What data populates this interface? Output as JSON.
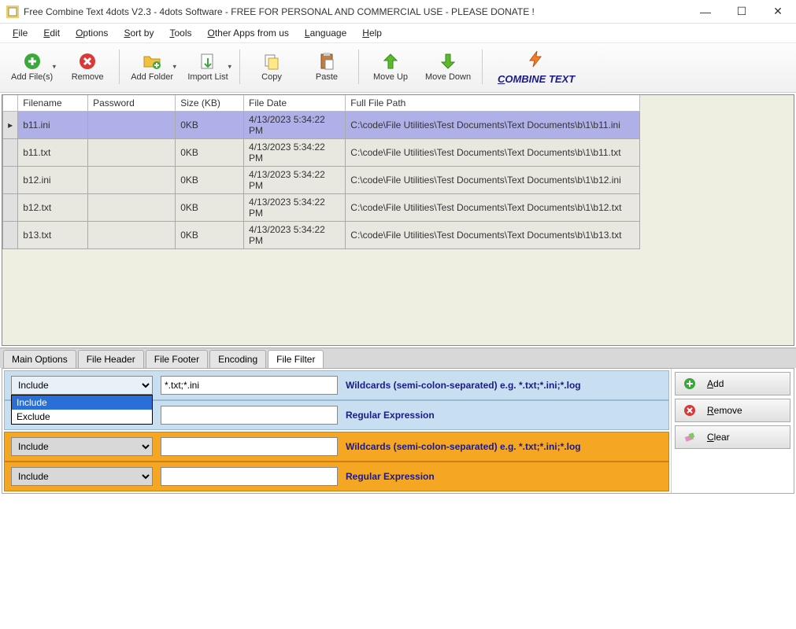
{
  "titlebar": {
    "title": "Free Combine Text 4dots V2.3 - 4dots Software - FREE FOR PERSONAL AND COMMERCIAL USE - PLEASE DONATE !"
  },
  "menus": [
    "File",
    "Edit",
    "Options",
    "Sort by",
    "Tools",
    "Other Apps from us",
    "Language",
    "Help"
  ],
  "toolbar": {
    "add_files": "Add File(s)",
    "remove": "Remove",
    "add_folder": "Add Folder",
    "import_list": "Import List",
    "copy": "Copy",
    "paste": "Paste",
    "move_up": "Move Up",
    "move_down": "Move Down",
    "combine": "COMBINE TEXT"
  },
  "table": {
    "headers": [
      "Filename",
      "Password",
      "Size (KB)",
      "File Date",
      "Full File Path"
    ],
    "rows": [
      {
        "filename": "b11.ini",
        "password": "",
        "size": "0KB",
        "date": "4/13/2023 5:34:22 PM",
        "path": "C:\\code\\File Utilities\\Test Documents\\Text Documents\\b\\1\\b11.ini",
        "selected": true
      },
      {
        "filename": "b11.txt",
        "password": "",
        "size": "0KB",
        "date": "4/13/2023 5:34:22 PM",
        "path": "C:\\code\\File Utilities\\Test Documents\\Text Documents\\b\\1\\b11.txt",
        "selected": false
      },
      {
        "filename": "b12.ini",
        "password": "",
        "size": "0KB",
        "date": "4/13/2023 5:34:22 PM",
        "path": "C:\\code\\File Utilities\\Test Documents\\Text Documents\\b\\1\\b12.ini",
        "selected": false
      },
      {
        "filename": "b12.txt",
        "password": "",
        "size": "0KB",
        "date": "4/13/2023 5:34:22 PM",
        "path": "C:\\code\\File Utilities\\Test Documents\\Text Documents\\b\\1\\b12.txt",
        "selected": false
      },
      {
        "filename": "b13.txt",
        "password": "",
        "size": "0KB",
        "date": "4/13/2023 5:34:22 PM",
        "path": "C:\\code\\File Utilities\\Test Documents\\Text Documents\\b\\1\\b13.txt",
        "selected": false
      }
    ]
  },
  "tabs": [
    "Main Options",
    "File Header",
    "File Footer",
    "Encoding",
    "File Filter"
  ],
  "active_tab": "File Filter",
  "filter": {
    "row1": {
      "mode": "Include",
      "value": "*.txt;*.ini",
      "label": "Wildcards (semi-colon-separated) e.g. *.txt;*.ini;*.log"
    },
    "row2": {
      "label": "Regular Expression",
      "value": ""
    },
    "dropdown_options": [
      "Include",
      "Exclude"
    ],
    "row3": {
      "mode": "Include",
      "value": "",
      "label": "Wildcards (semi-colon-separated) e.g. *.txt;*.ini;*.log"
    },
    "row4": {
      "mode": "Include",
      "value": "",
      "label": "Regular Expression"
    },
    "btn_add": "Add",
    "btn_remove": "Remove",
    "btn_clear": "Clear"
  }
}
